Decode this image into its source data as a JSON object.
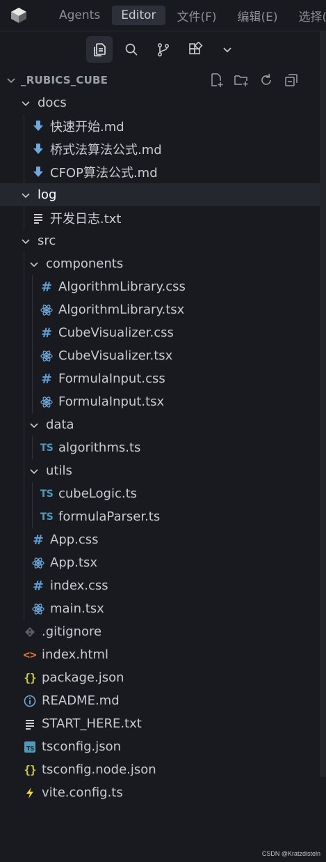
{
  "menu": {
    "items": [
      {
        "label": "Agents",
        "active": false
      },
      {
        "label": "Editor",
        "active": true
      },
      {
        "label": "文件(F)",
        "active": false
      },
      {
        "label": "编辑(E)",
        "active": false
      },
      {
        "label": "选择(S)",
        "active": false
      }
    ]
  },
  "activity_icons": [
    "files-icon",
    "search-icon",
    "source-control-icon",
    "extensions-icon",
    "chevron-down-icon"
  ],
  "explorer": {
    "title": "_RUBICS_CUBE",
    "actions": [
      "new-file-icon",
      "new-folder-icon",
      "refresh-icon",
      "collapse-all-icon"
    ]
  },
  "tree": [
    {
      "label": "docs",
      "depth": 1,
      "kind": "folder",
      "open": true
    },
    {
      "label": "快速开始.md",
      "depth": 2,
      "kind": "md"
    },
    {
      "label": "桥式法算法公式.md",
      "depth": 2,
      "kind": "md"
    },
    {
      "label": "CFOP算法公式.md",
      "depth": 2,
      "kind": "md"
    },
    {
      "label": "log",
      "depth": 1,
      "kind": "folder",
      "open": true,
      "selected": true
    },
    {
      "label": "开发日志.txt",
      "depth": 2,
      "kind": "txt"
    },
    {
      "label": "src",
      "depth": 1,
      "kind": "folder",
      "open": true
    },
    {
      "label": "components",
      "depth": 2,
      "kind": "folder",
      "open": true
    },
    {
      "label": "AlgorithmLibrary.css",
      "depth": 3,
      "kind": "css"
    },
    {
      "label": "AlgorithmLibrary.tsx",
      "depth": 3,
      "kind": "tsx"
    },
    {
      "label": "CubeVisualizer.css",
      "depth": 3,
      "kind": "css"
    },
    {
      "label": "CubeVisualizer.tsx",
      "depth": 3,
      "kind": "tsx"
    },
    {
      "label": "FormulaInput.css",
      "depth": 3,
      "kind": "css"
    },
    {
      "label": "FormulaInput.tsx",
      "depth": 3,
      "kind": "tsx"
    },
    {
      "label": "data",
      "depth": 2,
      "kind": "folder",
      "open": true
    },
    {
      "label": "algorithms.ts",
      "depth": 3,
      "kind": "ts"
    },
    {
      "label": "utils",
      "depth": 2,
      "kind": "folder",
      "open": true
    },
    {
      "label": "cubeLogic.ts",
      "depth": 3,
      "kind": "ts"
    },
    {
      "label": "formulaParser.ts",
      "depth": 3,
      "kind": "ts"
    },
    {
      "label": "App.css",
      "depth": 2,
      "kind": "css"
    },
    {
      "label": "App.tsx",
      "depth": 2,
      "kind": "tsx"
    },
    {
      "label": "index.css",
      "depth": 2,
      "kind": "css"
    },
    {
      "label": "main.tsx",
      "depth": 2,
      "kind": "tsx"
    },
    {
      "label": ".gitignore",
      "depth": 1,
      "kind": "git"
    },
    {
      "label": "index.html",
      "depth": 1,
      "kind": "html"
    },
    {
      "label": "package.json",
      "depth": 1,
      "kind": "json"
    },
    {
      "label": "README.md",
      "depth": 1,
      "kind": "info"
    },
    {
      "label": "START_HERE.txt",
      "depth": 1,
      "kind": "txt"
    },
    {
      "label": "tsconfig.json",
      "depth": 1,
      "kind": "tsconfig"
    },
    {
      "label": "tsconfig.node.json",
      "depth": 1,
      "kind": "json"
    },
    {
      "label": "vite.config.ts",
      "depth": 1,
      "kind": "vite"
    }
  ],
  "icon_names": {
    "folder": "chevron-down-icon",
    "md": "markdown-download-icon",
    "txt": "text-file-icon",
    "css": "css-hash-icon",
    "tsx": "react-icon",
    "ts": "typescript-icon",
    "git": "git-icon",
    "html": "html-code-icon",
    "json": "json-braces-icon",
    "info": "info-icon",
    "tsconfig": "tsconfig-icon",
    "vite": "vite-lightning-icon"
  },
  "colors": {
    "background": "#181a1f",
    "selected_row": "#24272e",
    "css": "#5aa0d6",
    "react": "#6fa8dc",
    "ts": "#519aba",
    "json": "#cbcb41",
    "html": "#e37933",
    "vite": "#f5d842"
  },
  "watermark": "CSDN @Kratzdisteln"
}
